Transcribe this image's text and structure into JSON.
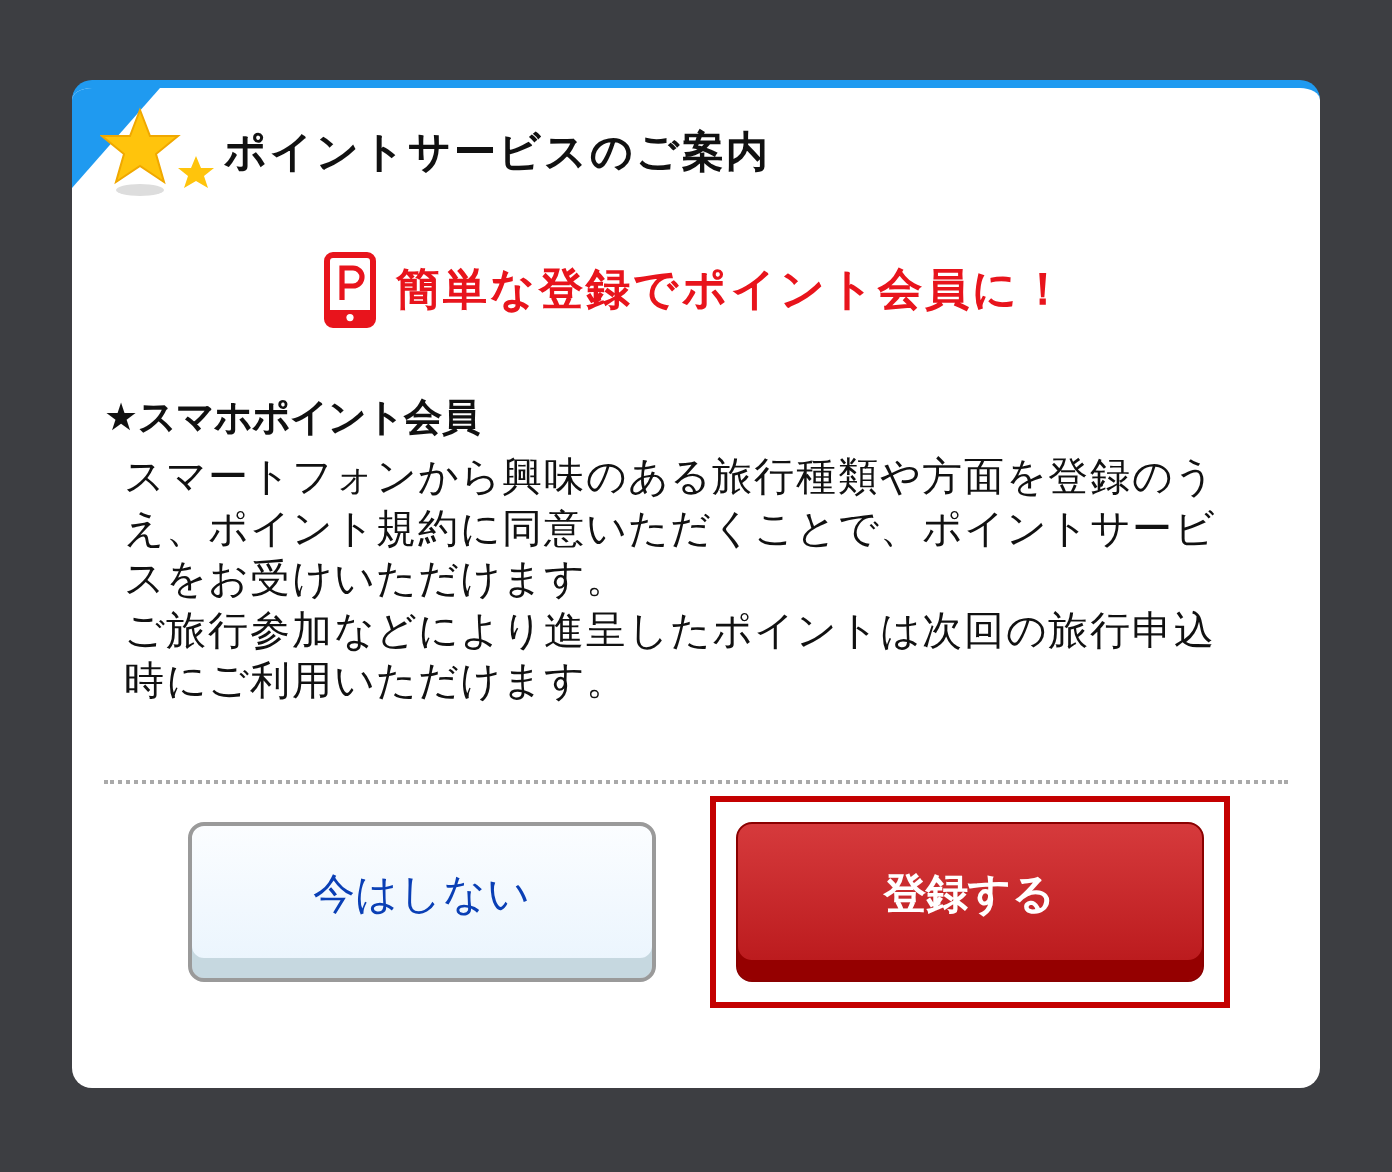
{
  "dialog": {
    "title": "ポイントサービスのご案内",
    "headline": "簡単な登録でポイント会員に！",
    "section_heading": "★スマホポイント会員",
    "paragraphs": [
      "スマートフォンから興味のある旅行種類や方面を登録のうえ、ポイント規約に同意いただくことで、ポイントサービスをお受けいただけます。",
      "ご旅行参加などにより進呈したポイントは次回の旅行申込時にご利用いただけます。"
    ]
  },
  "buttons": [
    {
      "label": "今はしない",
      "kind": "secondary",
      "highlighted": false
    },
    {
      "label": "登録する",
      "kind": "primary",
      "highlighted": true
    }
  ]
}
